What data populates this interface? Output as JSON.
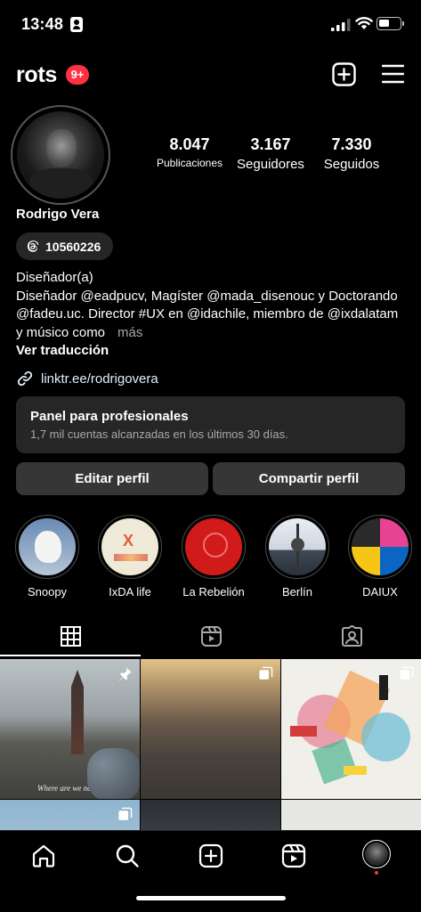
{
  "status_bar": {
    "time": "13:48"
  },
  "header": {
    "username": "rots",
    "notifications": "9+"
  },
  "profile": {
    "stats": [
      {
        "value": "8.047",
        "label": "Publicaciones"
      },
      {
        "value": "3.167",
        "label": "Seguidores"
      },
      {
        "value": "7.330",
        "label": "Seguidos"
      }
    ],
    "full_name": "Rodrigo Vera",
    "threads_handle": "10560226",
    "category": "Diseñador(a)",
    "bio": "Diseñador @eadpucv, Magíster @mada_disenouc y Doctorando @fadeu.uc. Director #UX en @idachile, miembro de @ixdalatam y músico como",
    "bio_more": "más",
    "translate": "Ver traducción",
    "link": "linktr.ee/rodrigovera"
  },
  "pro_panel": {
    "title": "Panel para profesionales",
    "subtitle": "1,7 mil cuentas alcanzadas en los últimos 30 días."
  },
  "actions": {
    "edit": "Editar perfil",
    "share": "Compartir perfil"
  },
  "highlights": [
    {
      "label": "Snoopy"
    },
    {
      "label": "IxDA life"
    },
    {
      "label": "La Rebelión"
    },
    {
      "label": "Berlín"
    },
    {
      "label": "DAIUX"
    }
  ],
  "grid": {
    "first_post_caption": "Where are we now?"
  },
  "colors": {
    "background": "#000000",
    "surface": "#262626",
    "button": "#363636",
    "badge": "#ff3040",
    "secondary_text": "#a8a8a8"
  },
  "icons": {
    "create": "plus-square-icon",
    "menu": "hamburger-menu-icon",
    "threads": "threads-icon",
    "link": "link-icon",
    "grid": "grid-icon",
    "reels": "reels-icon",
    "tagged": "tagged-icon",
    "home": "home-icon",
    "search": "search-icon",
    "pin": "pin-icon",
    "carousel": "carousel-icon"
  }
}
